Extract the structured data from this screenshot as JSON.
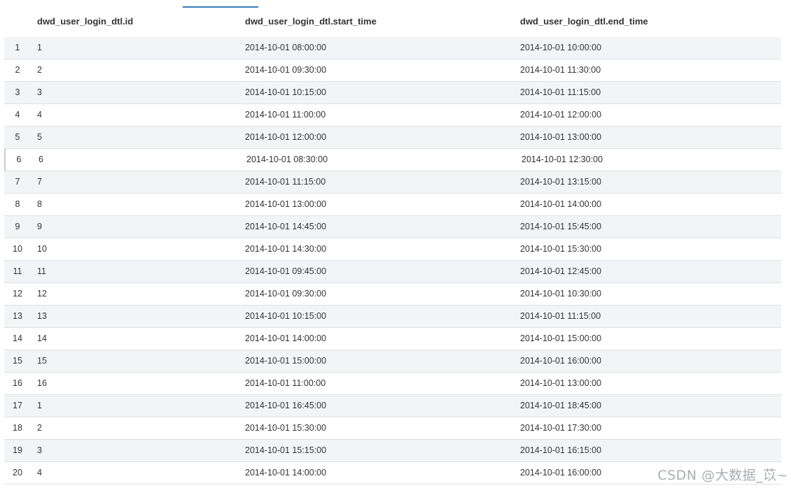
{
  "table": {
    "columns": [
      "dwd_user_login_dtl.id",
      "dwd_user_login_dtl.start_time",
      "dwd_user_login_dtl.end_time"
    ],
    "rows": [
      {
        "num": "1",
        "id": "1",
        "start_time": "2014-10-01 08:00:00",
        "end_time": "2014-10-01 10:00:00"
      },
      {
        "num": "2",
        "id": "2",
        "start_time": "2014-10-01 09:30:00",
        "end_time": "2014-10-01 11:30:00"
      },
      {
        "num": "3",
        "id": "3",
        "start_time": "2014-10-01 10:15:00",
        "end_time": "2014-10-01 11:15:00"
      },
      {
        "num": "4",
        "id": "4",
        "start_time": "2014-10-01 11:00:00",
        "end_time": "2014-10-01 12:00:00"
      },
      {
        "num": "5",
        "id": "5",
        "start_time": "2014-10-01 12:00:00",
        "end_time": "2014-10-01 13:00:00"
      },
      {
        "num": "6",
        "id": "6",
        "start_time": "2014-10-01 08:30:00",
        "end_time": "2014-10-01 12:30:00"
      },
      {
        "num": "7",
        "id": "7",
        "start_time": "2014-10-01 11:15:00",
        "end_time": "2014-10-01 13:15:00"
      },
      {
        "num": "8",
        "id": "8",
        "start_time": "2014-10-01 13:00:00",
        "end_time": "2014-10-01 14:00:00"
      },
      {
        "num": "9",
        "id": "9",
        "start_time": "2014-10-01 14:45:00",
        "end_time": "2014-10-01 15:45:00"
      },
      {
        "num": "10",
        "id": "10",
        "start_time": "2014-10-01 14:30:00",
        "end_time": "2014-10-01 15:30:00"
      },
      {
        "num": "11",
        "id": "11",
        "start_time": "2014-10-01 09:45:00",
        "end_time": "2014-10-01 12:45:00"
      },
      {
        "num": "12",
        "id": "12",
        "start_time": "2014-10-01 09:30:00",
        "end_time": "2014-10-01 10:30:00"
      },
      {
        "num": "13",
        "id": "13",
        "start_time": "2014-10-01 10:15:00",
        "end_time": "2014-10-01 11:15:00"
      },
      {
        "num": "14",
        "id": "14",
        "start_time": "2014-10-01 14:00:00",
        "end_time": "2014-10-01 15:00:00"
      },
      {
        "num": "15",
        "id": "15",
        "start_time": "2014-10-01 15:00:00",
        "end_time": "2014-10-01 16:00:00"
      },
      {
        "num": "16",
        "id": "16",
        "start_time": "2014-10-01 11:00:00",
        "end_time": "2014-10-01 13:00:00"
      },
      {
        "num": "17",
        "id": "1",
        "start_time": "2014-10-01 16:45:00",
        "end_time": "2014-10-01 18:45:00"
      },
      {
        "num": "18",
        "id": "2",
        "start_time": "2014-10-01 15:30:00",
        "end_time": "2014-10-01 17:30:00"
      },
      {
        "num": "19",
        "id": "3",
        "start_time": "2014-10-01 15:15:00",
        "end_time": "2014-10-01 16:15:00"
      },
      {
        "num": "20",
        "id": "4",
        "start_time": "2014-10-01 14:00:00",
        "end_time": "2014-10-01 16:00:00"
      }
    ]
  },
  "watermark": "CSDN @大数据_苡~",
  "colors": {
    "accent": "#3a78b5",
    "row_alt": "#f3f4f6",
    "border": "#dde1e5"
  }
}
